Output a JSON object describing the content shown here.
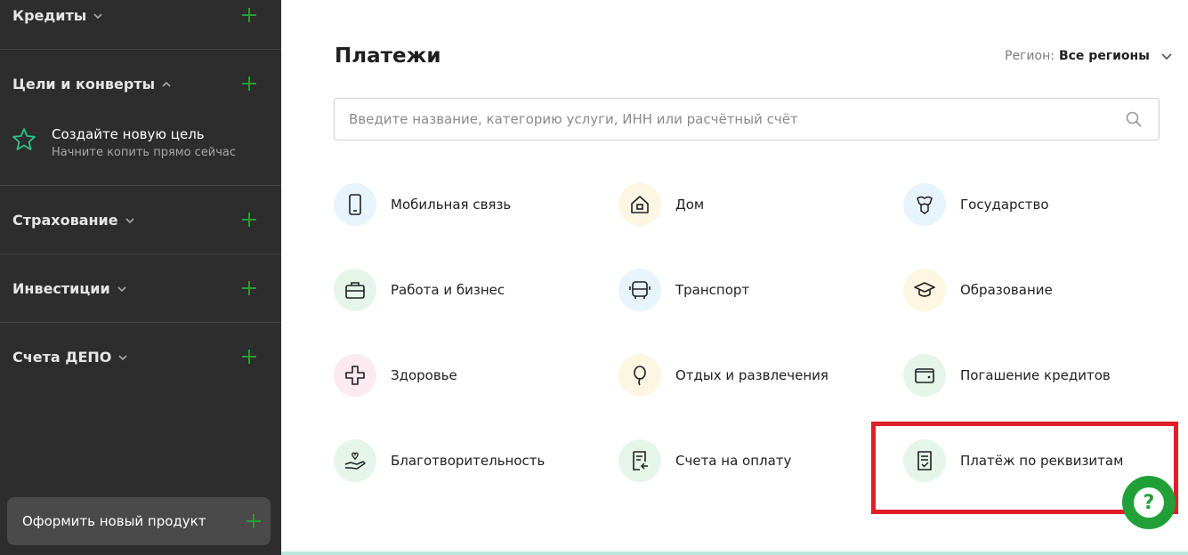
{
  "sidebar": {
    "credits": {
      "label": "Кредиты"
    },
    "goals": {
      "label": "Цели и конверты"
    },
    "new_goal": {
      "title": "Создайте новую цель",
      "subtitle": "Начните копить прямо сейчас"
    },
    "insurance": {
      "label": "Страхование"
    },
    "investments": {
      "label": "Инвестиции"
    },
    "depo": {
      "label": "Счета ДЕПО"
    },
    "new_product_label": "Оформить новый продукт"
  },
  "main": {
    "title": "Платежи",
    "region": {
      "label": "Регион:",
      "value": "Все регионы"
    },
    "search": {
      "placeholder": "Введите название, категорию услуги, ИНН или расчётный счёт",
      "value": ""
    },
    "categories": [
      {
        "label": "Мобильная связь",
        "icon": "mobile-phone-icon"
      },
      {
        "label": "Дом",
        "icon": "house-icon"
      },
      {
        "label": "Государство",
        "icon": "state-emblem-icon"
      },
      {
        "label": "Работа и бизнес",
        "icon": "briefcase-icon"
      },
      {
        "label": "Транспорт",
        "icon": "bus-icon"
      },
      {
        "label": "Образование",
        "icon": "graduation-cap-icon"
      },
      {
        "label": "Здоровье",
        "icon": "medical-cross-icon"
      },
      {
        "label": "Отдых и развлечения",
        "icon": "balloon-icon"
      },
      {
        "label": "Погашение кредитов",
        "icon": "wallet-icon"
      },
      {
        "label": "Благотворительность",
        "icon": "charity-hand-icon"
      },
      {
        "label": "Счета на оплату",
        "icon": "invoice-icon"
      },
      {
        "label": "Платёж по реквизитам",
        "icon": "document-check-icon"
      }
    ],
    "help_label": "?"
  },
  "colors": {
    "sidebar_bg": "#2d2d2d",
    "accent_green": "#21a038",
    "highlight_red": "#e01e28"
  }
}
